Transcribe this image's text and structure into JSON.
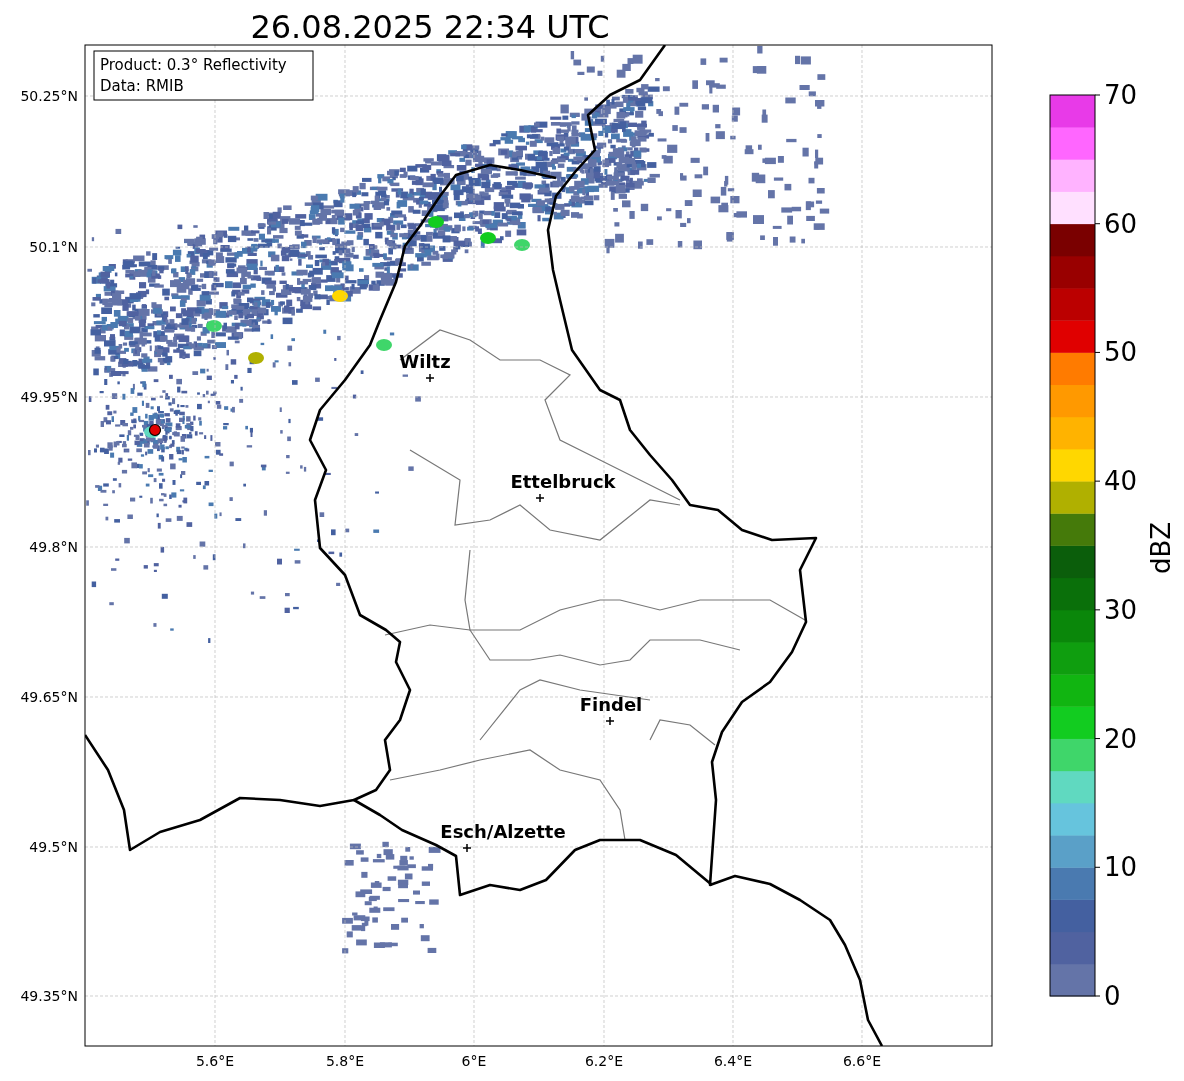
{
  "title": "26.08.2025 22:34 UTC",
  "info_box": [
    "Product: 0.3° Reflectivity",
    "Data: RMIB"
  ],
  "cities": [
    "Wiltz",
    "Ettelbruck",
    "Findel",
    "Esch/Alzette"
  ],
  "lat_ticks": [
    "50.25°N",
    "50.1°N",
    "49.95°N",
    "49.8°N",
    "49.65°N",
    "49.5°N",
    "49.35°N"
  ],
  "lon_ticks": [
    "5.6°E",
    "5.8°E",
    "6°E",
    "6.2°E",
    "6.4°E",
    "6.6°E"
  ],
  "colorbar": {
    "label": "dBZ",
    "ticks": [
      "70",
      "60",
      "50",
      "40",
      "30",
      "20",
      "10",
      "0"
    ],
    "bins": [
      {
        "color": "#6474a8"
      },
      {
        "color": "#5062a0"
      },
      {
        "color": "#4460a0"
      },
      {
        "color": "#4a7ab0"
      },
      {
        "color": "#5aa0c8"
      },
      {
        "color": "#66c4dd"
      },
      {
        "color": "#60d9c0"
      },
      {
        "color": "#3fd66a"
      },
      {
        "color": "#12cc20"
      },
      {
        "color": "#11b511"
      },
      {
        "color": "#0f9e0f"
      },
      {
        "color": "#0a870a"
      },
      {
        "color": "#0a700a"
      },
      {
        "color": "#0b5e0b"
      },
      {
        "color": "#457a0a"
      },
      {
        "color": "#b0b000"
      },
      {
        "color": "#ffd700"
      },
      {
        "color": "#ffb300"
      },
      {
        "color": "#ff9900"
      },
      {
        "color": "#ff7b00"
      },
      {
        "color": "#e00000"
      },
      {
        "color": "#bb0000"
      },
      {
        "color": "#990000"
      },
      {
        "color": "#7a0000"
      },
      {
        "color": "#ffe0ff"
      },
      {
        "color": "#ffb3ff"
      },
      {
        "color": "#ff66ff"
      },
      {
        "color": "#e83ae8"
      }
    ]
  }
}
